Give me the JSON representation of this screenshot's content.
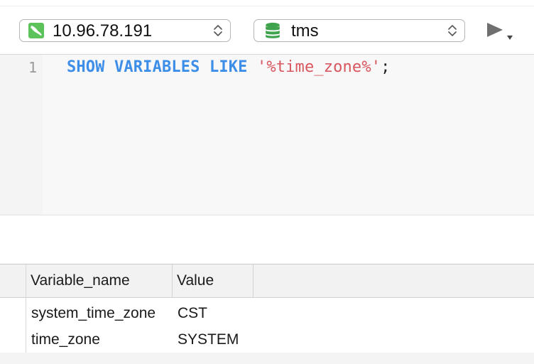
{
  "toolbar": {
    "server": {
      "label": "10.96.78.191",
      "icon": "mysql-dolphin-icon",
      "icon_color": "#5cc25a"
    },
    "database": {
      "label": "tms",
      "icon": "database-icon",
      "icon_color": "#3fa34d"
    },
    "run_button": {
      "icon": "play-icon",
      "menu_icon": "dropdown-arrow-icon"
    }
  },
  "editor": {
    "lines": [
      {
        "number": "1",
        "tokens": {
          "kw1": "SHOW",
          "kw2": "VARIABLES",
          "kw3": "LIKE",
          "string": "'%time_zone%'",
          "terminator": ";"
        }
      }
    ],
    "colors": {
      "keyword": "#3c8ee8",
      "string": "#d8565e"
    }
  },
  "results": {
    "columns": [
      "Variable_name",
      "Value"
    ],
    "rows": [
      [
        "system_time_zone",
        "CST"
      ],
      [
        "time_zone",
        "SYSTEM"
      ]
    ]
  }
}
